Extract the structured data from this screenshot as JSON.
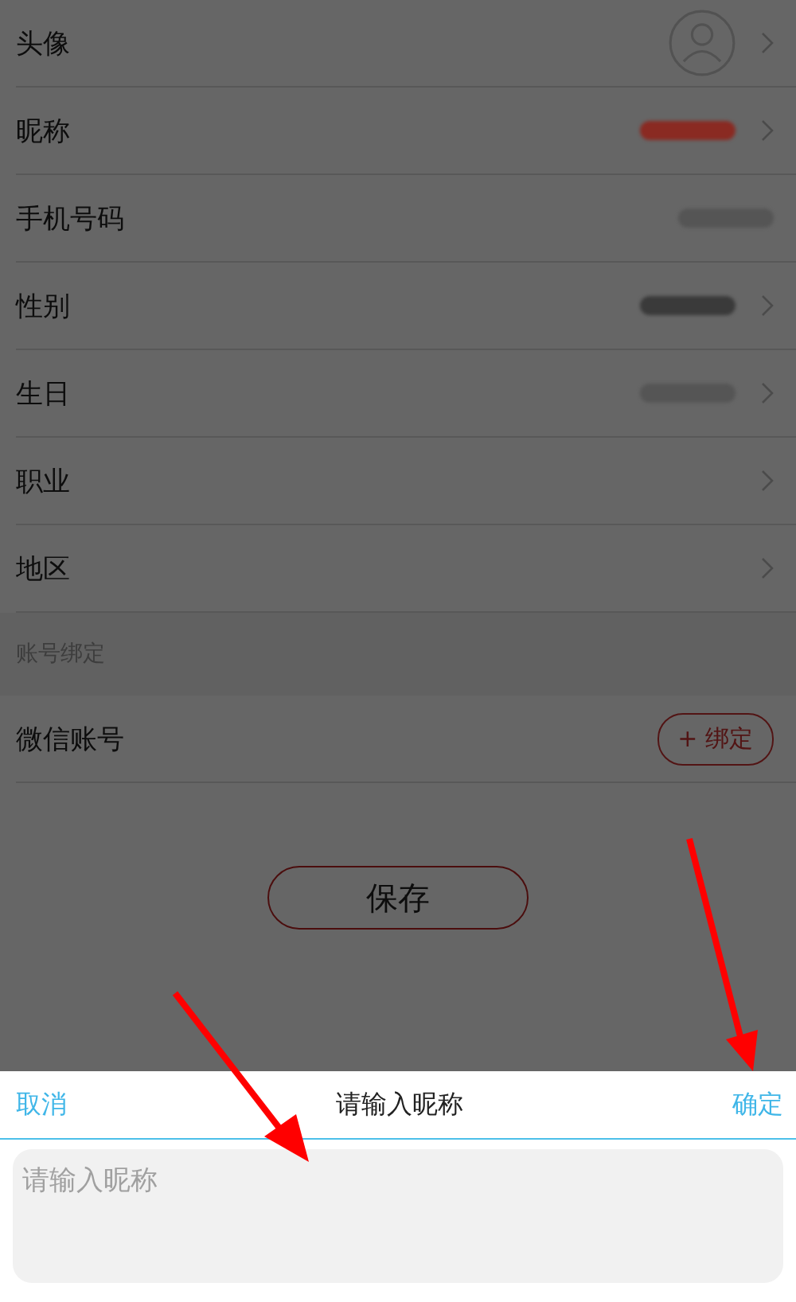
{
  "profile_rows": [
    {
      "label": "头像",
      "kind": "avatar",
      "chevron": true
    },
    {
      "label": "昵称",
      "kind": "redacted",
      "color": "#8a2a22",
      "chevron": true
    },
    {
      "label": "手机号码",
      "kind": "redacted",
      "color": "#555555",
      "chevron": false
    },
    {
      "label": "性别",
      "kind": "redacted",
      "color": "#3a3a3a",
      "chevron": true
    },
    {
      "label": "生日",
      "kind": "redacted",
      "color": "#555555",
      "chevron": true
    },
    {
      "label": "职业",
      "kind": "plain",
      "chevron": true
    },
    {
      "label": "地区",
      "kind": "plain",
      "chevron": true
    }
  ],
  "section_header": "账号绑定",
  "binding_row": {
    "label": "微信账号",
    "button": "+ 绑定"
  },
  "save_button": "保存",
  "dialog": {
    "cancel": "取消",
    "title": "请输入昵称",
    "confirm": "确定",
    "input": {
      "placeholder": "请输入昵称"
    }
  }
}
